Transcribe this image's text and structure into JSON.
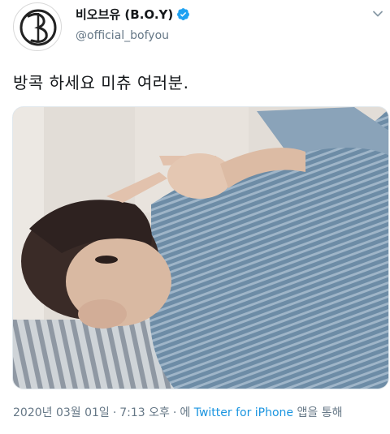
{
  "tweet": {
    "display_name": "비오브유 (B.O.Y)",
    "handle": "@official_bofyou",
    "verified": true,
    "text": "방콕 하세요 미츄 여러분.",
    "media": {
      "icon": "photo",
      "description_hidden": true
    },
    "timestamp": {
      "date": "2020년 03월 01일",
      "separator": "·",
      "time": "7:13 오후",
      "via_prefix": "에",
      "source": "Twitter for iPhone",
      "via_suffix": "앱을 통해"
    }
  },
  "colors": {
    "link": "#1b95e0",
    "verified": "#1da1f2",
    "secondary_text": "#657786"
  },
  "icons": {
    "verified": "verified-badge-icon",
    "menu": "chevron-down-icon",
    "avatar": "bofyou-logo-icon"
  }
}
